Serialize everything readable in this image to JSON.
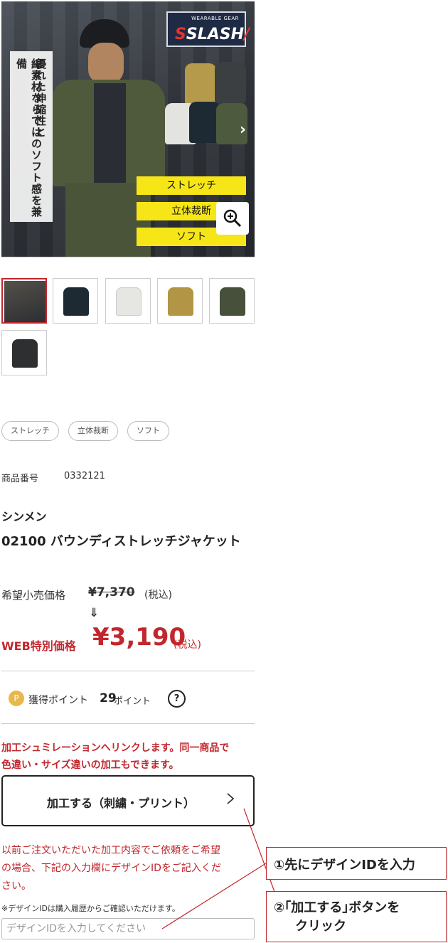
{
  "hero": {
    "catch_lines": [
      "優れた伸縮性と",
      "綿素材ならではのソフト感を兼備"
    ],
    "brand_small": "WEARABLE GEAR",
    "brand_big": "SLASH",
    "tags": [
      "ストレッチ",
      "立体裁断",
      "ソフト"
    ]
  },
  "features": [
    "ストレッチ",
    "立体裁断",
    "ソフト"
  ],
  "product": {
    "number_label": "商品番号",
    "number": "0332121",
    "maker": "シンメン",
    "name": "02100 バウンディストレッチジャケット"
  },
  "price": {
    "msrp_label": "希望小売価格",
    "msrp": "¥7,370",
    "tax_note": "(税込)",
    "arrow": "⇓",
    "web_label": "WEB特別価格",
    "web_price": "¥3,190",
    "web_tax_note": "(税込)"
  },
  "points": {
    "icon": "P",
    "label": "獲得ポイント",
    "value": "29",
    "unit": "ポイント",
    "help": "?"
  },
  "customize": {
    "note_line1": "加工シュミレーションへリンクします。同一商品で",
    "note_line2": "色違い・サイズ違いの加工もできます。",
    "button_label": "加工する（刺繍・プリント）",
    "reorder_line1": "以前ご注文いただいた加工内容でご依頼をご希望",
    "reorder_line2": "の場合、下記の入力欄にデザインIDをご記入くだ",
    "reorder_line3": "さい。",
    "small_note": "※デザインIDは購入履歴からご確認いただけます。",
    "input_placeholder": "デザインIDを入力してください"
  },
  "callouts": {
    "first": "①先にデザインIDを入力",
    "second_line1": "②｢加工する｣ボタンを",
    "second_line2": "クリック"
  },
  "colors": {
    "accent_red": "#c1272d",
    "tag_yellow": "#f6e618",
    "point_gold": "#e8b84a"
  }
}
